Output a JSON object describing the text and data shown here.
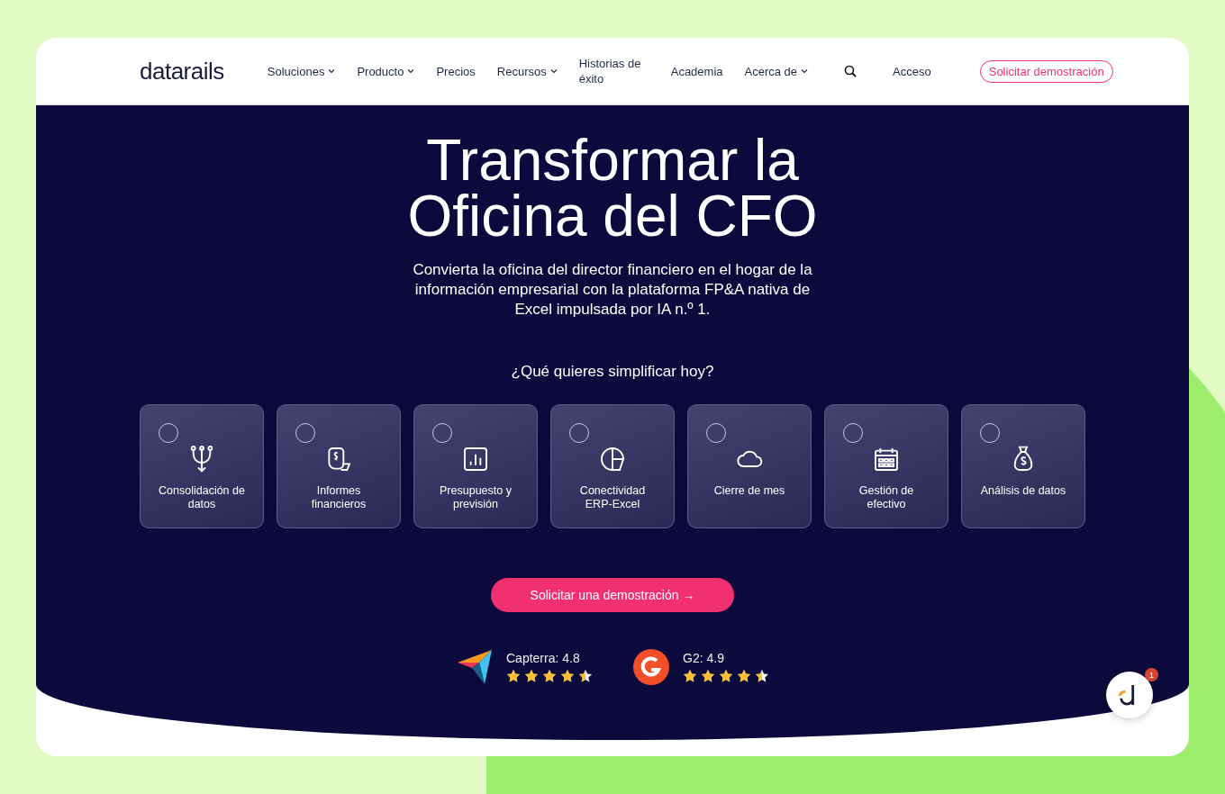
{
  "nav": {
    "logo": "datarails",
    "items": [
      {
        "label": "Soluciones",
        "dropdown": true
      },
      {
        "label": "Producto",
        "dropdown": true
      },
      {
        "label": "Precios",
        "dropdown": false
      },
      {
        "label": "Recursos",
        "dropdown": true
      },
      {
        "label": "Historias de éxito",
        "dropdown": false
      },
      {
        "label": "Academia",
        "dropdown": false
      },
      {
        "label": "Acerca de",
        "dropdown": true
      }
    ],
    "login": "Acceso",
    "demo_button": "Solicitar demostración"
  },
  "hero": {
    "title": "Transformar la Oficina del CFO",
    "subtitle": "Convierta la oficina del director financiero en el hogar de la información empresarial con la plataforma FP&A nativa de Excel impulsada por IA n.º 1.",
    "question": "¿Qué quieres simplificar hoy?",
    "options": [
      {
        "label": "Consolidación de datos",
        "kind": "fork",
        "selected": false
      },
      {
        "label": "Informes financieros",
        "kind": "receipt",
        "selected": false
      },
      {
        "label": "Presupuesto y previsión",
        "kind": "chart",
        "selected": false
      },
      {
        "label": "Conectividad ERP-Excel",
        "kind": "pie",
        "selected": false
      },
      {
        "label": "Cierre de mes",
        "kind": "cloud",
        "selected": false
      },
      {
        "label": "Gestión de efectivo",
        "kind": "calendar",
        "selected": false
      },
      {
        "label": "Análisis de datos",
        "kind": "moneybag",
        "selected": false
      }
    ],
    "cta": "Solicitar una demostración →",
    "ratings": [
      {
        "kind": "capterra",
        "label": "Capterra: 4.8",
        "stars": 4.5
      },
      {
        "kind": "g2",
        "label": "G2: 4.9",
        "stars": 4.5
      }
    ]
  },
  "chat": {
    "badge": "1"
  }
}
